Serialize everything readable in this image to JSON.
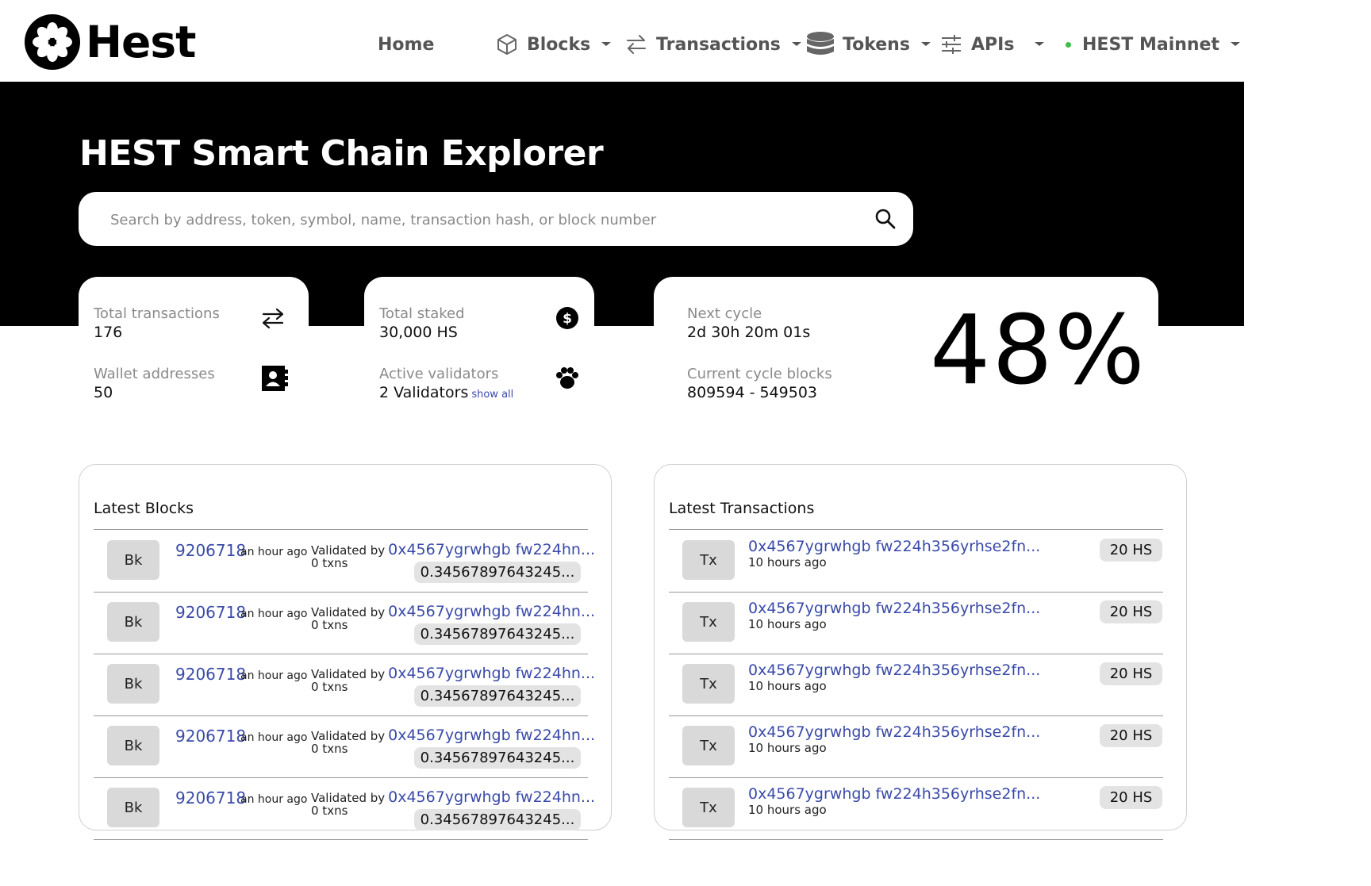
{
  "brand": {
    "name": "Hest"
  },
  "nav": {
    "home": "Home",
    "blocks": "Blocks",
    "transactions": "Transactions",
    "tokens": "Tokens",
    "apis": "APIs",
    "network": "HEST Mainnet",
    "network_status_color": "#3cbf4a"
  },
  "hero": {
    "title": "HEST Smart Chain Explorer",
    "search_placeholder": "Search by address, token, symbol, name, transaction hash, or block number"
  },
  "stats": {
    "total_transactions_label": "Total transactions",
    "total_transactions_value": "176",
    "wallet_addresses_label": "Wallet addresses",
    "wallet_addresses_value": "50",
    "total_staked_label": "Total staked",
    "total_staked_value": "30,000 HS",
    "active_validators_label": "Active validators",
    "active_validators_value": "2 Validators",
    "show_all": "show all",
    "next_cycle_label": "Next cycle",
    "next_cycle_value": "2d 30h 20m 01s",
    "current_cycle_blocks_label": "Current cycle blocks",
    "current_cycle_blocks_value": "809594 - 549503",
    "cycle_percent": "48%"
  },
  "latest_blocks": {
    "title": "Latest Blocks",
    "rows": [
      {
        "badge": "Bk",
        "number": "9206718",
        "ago": "an hour ago",
        "validated_by": "Validated by",
        "validator": "0x4567ygrwhgb fw224hn...",
        "txns": "0 txns",
        "reward": "0.34567897643245..."
      },
      {
        "badge": "Bk",
        "number": "9206718",
        "ago": "an hour ago",
        "validated_by": "Validated by",
        "validator": "0x4567ygrwhgb fw224hn...",
        "txns": "0 txns",
        "reward": "0.34567897643245..."
      },
      {
        "badge": "Bk",
        "number": "9206718",
        "ago": "an hour ago",
        "validated_by": "Validated by",
        "validator": "0x4567ygrwhgb fw224hn...",
        "txns": "0 txns",
        "reward": "0.34567897643245..."
      },
      {
        "badge": "Bk",
        "number": "9206718",
        "ago": "an hour ago",
        "validated_by": "Validated by",
        "validator": "0x4567ygrwhgb fw224hn...",
        "txns": "0 txns",
        "reward": "0.34567897643245..."
      },
      {
        "badge": "Bk",
        "number": "9206718",
        "ago": "an hour ago",
        "validated_by": "Validated by",
        "validator": "0x4567ygrwhgb fw224hn...",
        "txns": "0 txns",
        "reward": "0.34567897643245..."
      }
    ]
  },
  "latest_transactions": {
    "title": "Latest Transactions",
    "rows": [
      {
        "badge": "Tx",
        "hash": "0x4567ygrwhgb fw224h356yrhse2fn...",
        "ago": "10 hours ago",
        "amount": "20 HS"
      },
      {
        "badge": "Tx",
        "hash": "0x4567ygrwhgb fw224h356yrhse2fn...",
        "ago": "10 hours ago",
        "amount": "20 HS"
      },
      {
        "badge": "Tx",
        "hash": "0x4567ygrwhgb fw224h356yrhse2fn...",
        "ago": "10 hours ago",
        "amount": "20 HS"
      },
      {
        "badge": "Tx",
        "hash": "0x4567ygrwhgb fw224h356yrhse2fn...",
        "ago": "10 hours ago",
        "amount": "20 HS"
      },
      {
        "badge": "Tx",
        "hash": "0x4567ygrwhgb fw224h356yrhse2fn...",
        "ago": "10 hours ago",
        "amount": "20 HS"
      }
    ]
  }
}
